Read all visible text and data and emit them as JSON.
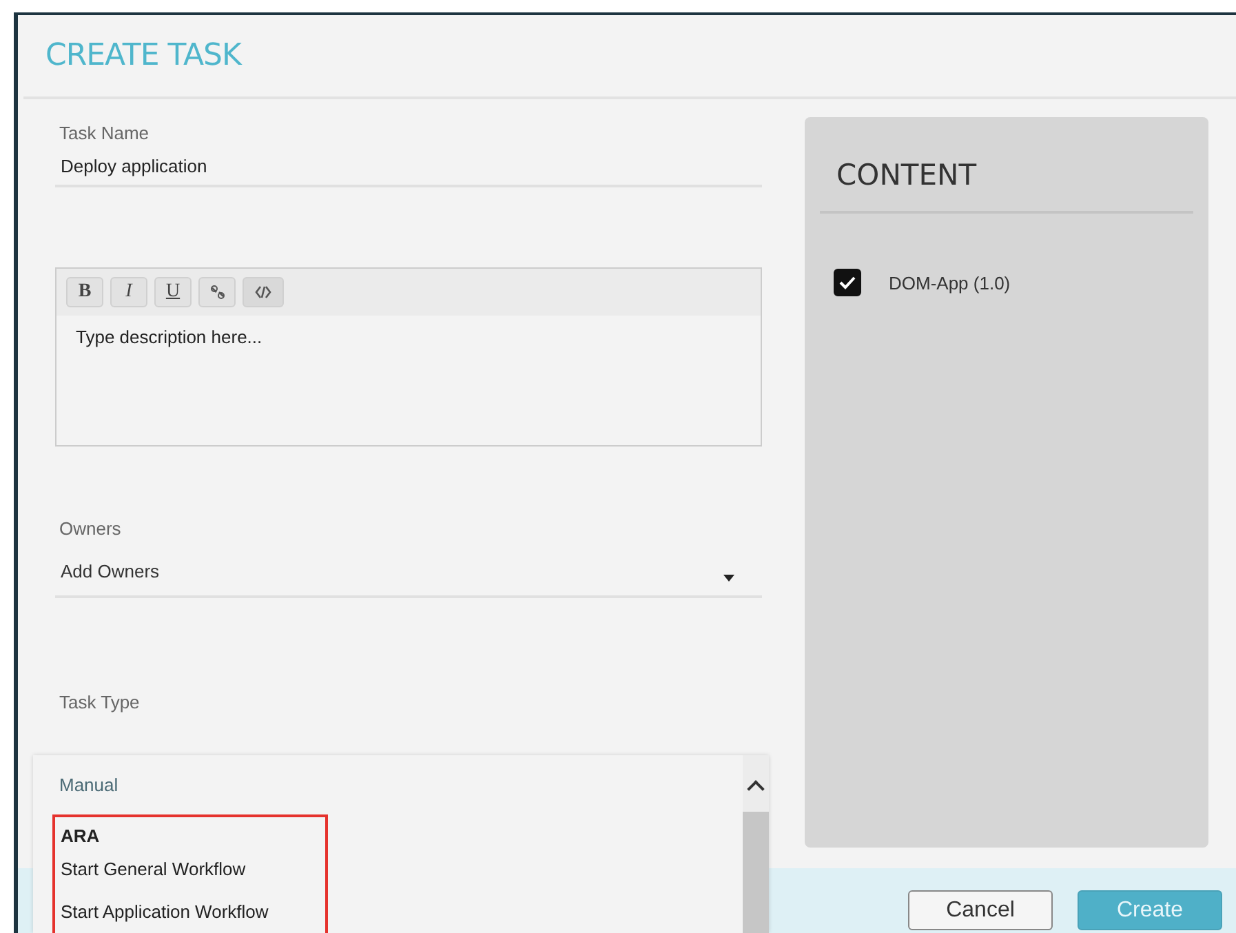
{
  "dialog": {
    "title": "CREATE TASK"
  },
  "task_name": {
    "label": "Task Name",
    "value": "Deploy application"
  },
  "description": {
    "toolbar": [
      "B",
      "I",
      "U"
    ],
    "placeholder": "Type description here..."
  },
  "owners": {
    "label": "Owners",
    "placeholder": "Add Owners"
  },
  "task_type": {
    "label": "Task Type",
    "value": "Manual",
    "expanded": true,
    "options": [
      {
        "label": "ARA",
        "kind": "group",
        "annotated": true
      },
      {
        "label": "Start General Workflow",
        "kind": "option",
        "annotated": true
      },
      {
        "label": "Start Application Workflow",
        "kind": "option",
        "annotated": true
      }
    ]
  },
  "content": {
    "title": "CONTENT",
    "items": [
      {
        "label": "DOM-App (1.0)",
        "checked": true
      }
    ]
  },
  "buttons": [
    {
      "label": "Cancel",
      "kind": "secondary"
    },
    {
      "label": "Create",
      "kind": "primary"
    }
  ]
}
